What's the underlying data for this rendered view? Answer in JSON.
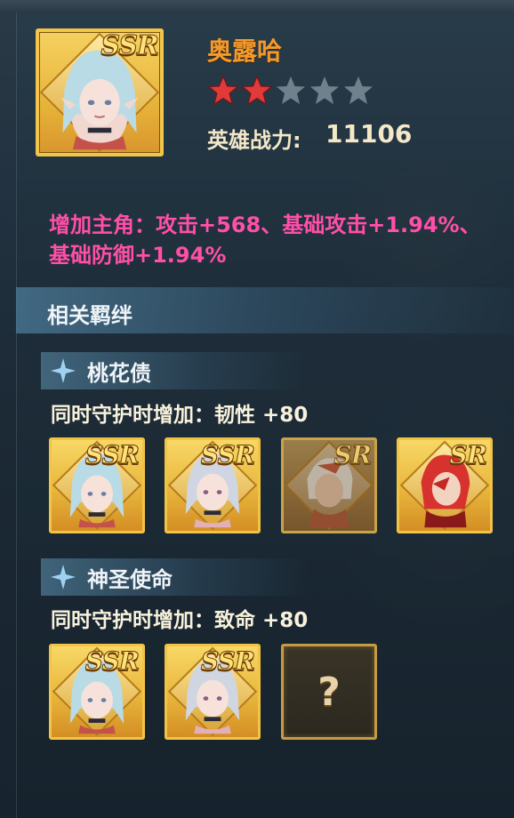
{
  "hero": {
    "name": "奥露哈",
    "rarity_badge": "SSR",
    "stars_total": 5,
    "stars_filled": 2,
    "power_label": "英雄战力:",
    "power_value": "11106"
  },
  "bonus_text": "增加主角：攻击+568、基础攻击+1.94%、基础防御+1.94%",
  "section": {
    "title": "相关羁绊"
  },
  "bonds": [
    {
      "title": "桃花债",
      "effect": "同时守护时增加：韧性 +80",
      "cards": [
        {
          "badge": "SSR",
          "state": "owned",
          "portrait": "white-haired-elf-girl"
        },
        {
          "badge": "SSR",
          "state": "owned",
          "portrait": "white-haired-elf-girl-2"
        },
        {
          "badge": "SR",
          "state": "locked",
          "portrait": "red-white-warrior"
        },
        {
          "badge": "SR",
          "state": "owned",
          "portrait": "red-haired-warrior"
        }
      ]
    },
    {
      "title": "神圣使命",
      "effect": "同时守护时增加：致命 +80",
      "cards": [
        {
          "badge": "SSR",
          "state": "owned",
          "portrait": "white-haired-elf-girl"
        },
        {
          "badge": "SSR",
          "state": "owned",
          "portrait": "white-haired-elf-girl-2"
        },
        {
          "badge": "?",
          "state": "unknown",
          "portrait": ""
        }
      ]
    }
  ],
  "colors": {
    "name": "#f49a2a",
    "bonus": "#ff4fa8",
    "star_filled": "#e03a3a",
    "star_empty": "#8a9aa6",
    "gold_frame": "#f2c445"
  }
}
